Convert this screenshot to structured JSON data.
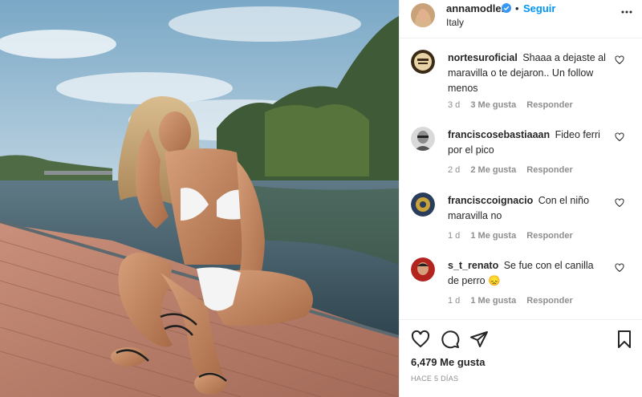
{
  "header": {
    "username": "annamodler",
    "separator": "•",
    "follow_label": "Seguir",
    "location": "Italy"
  },
  "icons": {
    "verified": "verified-badge-icon",
    "more": "more-options-icon",
    "like": "heart-icon",
    "comment": "comment-icon",
    "share": "paper-plane-icon",
    "save": "bookmark-icon"
  },
  "colors": {
    "accent": "#0095f6",
    "muted": "#8e8e8e",
    "text": "#262626"
  },
  "comments": [
    {
      "username": "nortesuroficial",
      "text": "Shaaa a dejaste al maravilla o te dejaron.. Un follow menos",
      "age": "3 d",
      "likes": "3 Me gusta",
      "reply": "Responder"
    },
    {
      "username": "francisco​sebastiaaan",
      "text": "Fideo ferri por el pico",
      "age": "2 d",
      "likes": "2 Me gusta",
      "reply": "Responder"
    },
    {
      "username": "franciscc​oignacio",
      "text": "Con el niño maravilla no",
      "age": "1 d",
      "likes": "1 Me gusta",
      "reply": "Responder"
    },
    {
      "username": "s_t_renato",
      "text": "Se fue con el canilla de perro 😞",
      "age": "1 d",
      "likes": "1 Me gusta",
      "reply": "Responder"
    }
  ],
  "footer": {
    "likes_count": "6,479 Me gusta",
    "posted_ago": "HACE 5 DÍAS"
  }
}
